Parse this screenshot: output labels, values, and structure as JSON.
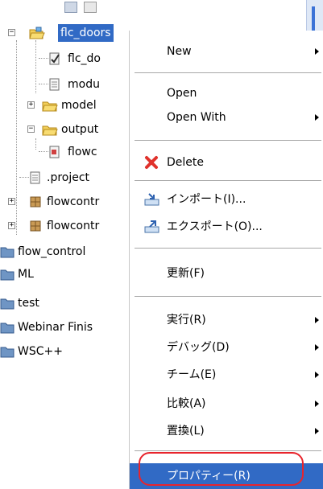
{
  "tree": {
    "partial_row_text": "",
    "items": [
      {
        "label": "flc_doors",
        "selected": true
      },
      {
        "label": "flc_do"
      },
      {
        "label": "modu"
      },
      {
        "label": "model"
      },
      {
        "label": "output"
      },
      {
        "label": "flowc"
      },
      {
        "label": ".project"
      },
      {
        "label": "flowcontr"
      },
      {
        "label": "flowcontr"
      },
      {
        "label": "flow_control"
      },
      {
        "label": "ML"
      },
      {
        "label": "test"
      },
      {
        "label": "Webinar Finis"
      },
      {
        "label": "WSC++"
      }
    ]
  },
  "menu": {
    "new": "New",
    "open": "Open",
    "open_with": "Open With",
    "delete": "Delete",
    "import": "インポート(I)...",
    "export": "エクスポート(O)...",
    "refresh": "更新(F)",
    "run": "実行(R)",
    "debug": "デバッグ(D)",
    "team": "チーム(E)",
    "compare": "比較(A)",
    "replace": "置換(L)",
    "properties": "プロパティー(R)"
  },
  "colors": {
    "selection": "#316ac5",
    "annotation_ring": "#e8242c",
    "folder": "#f2cf5a",
    "project_folder": "#6f95c4"
  }
}
